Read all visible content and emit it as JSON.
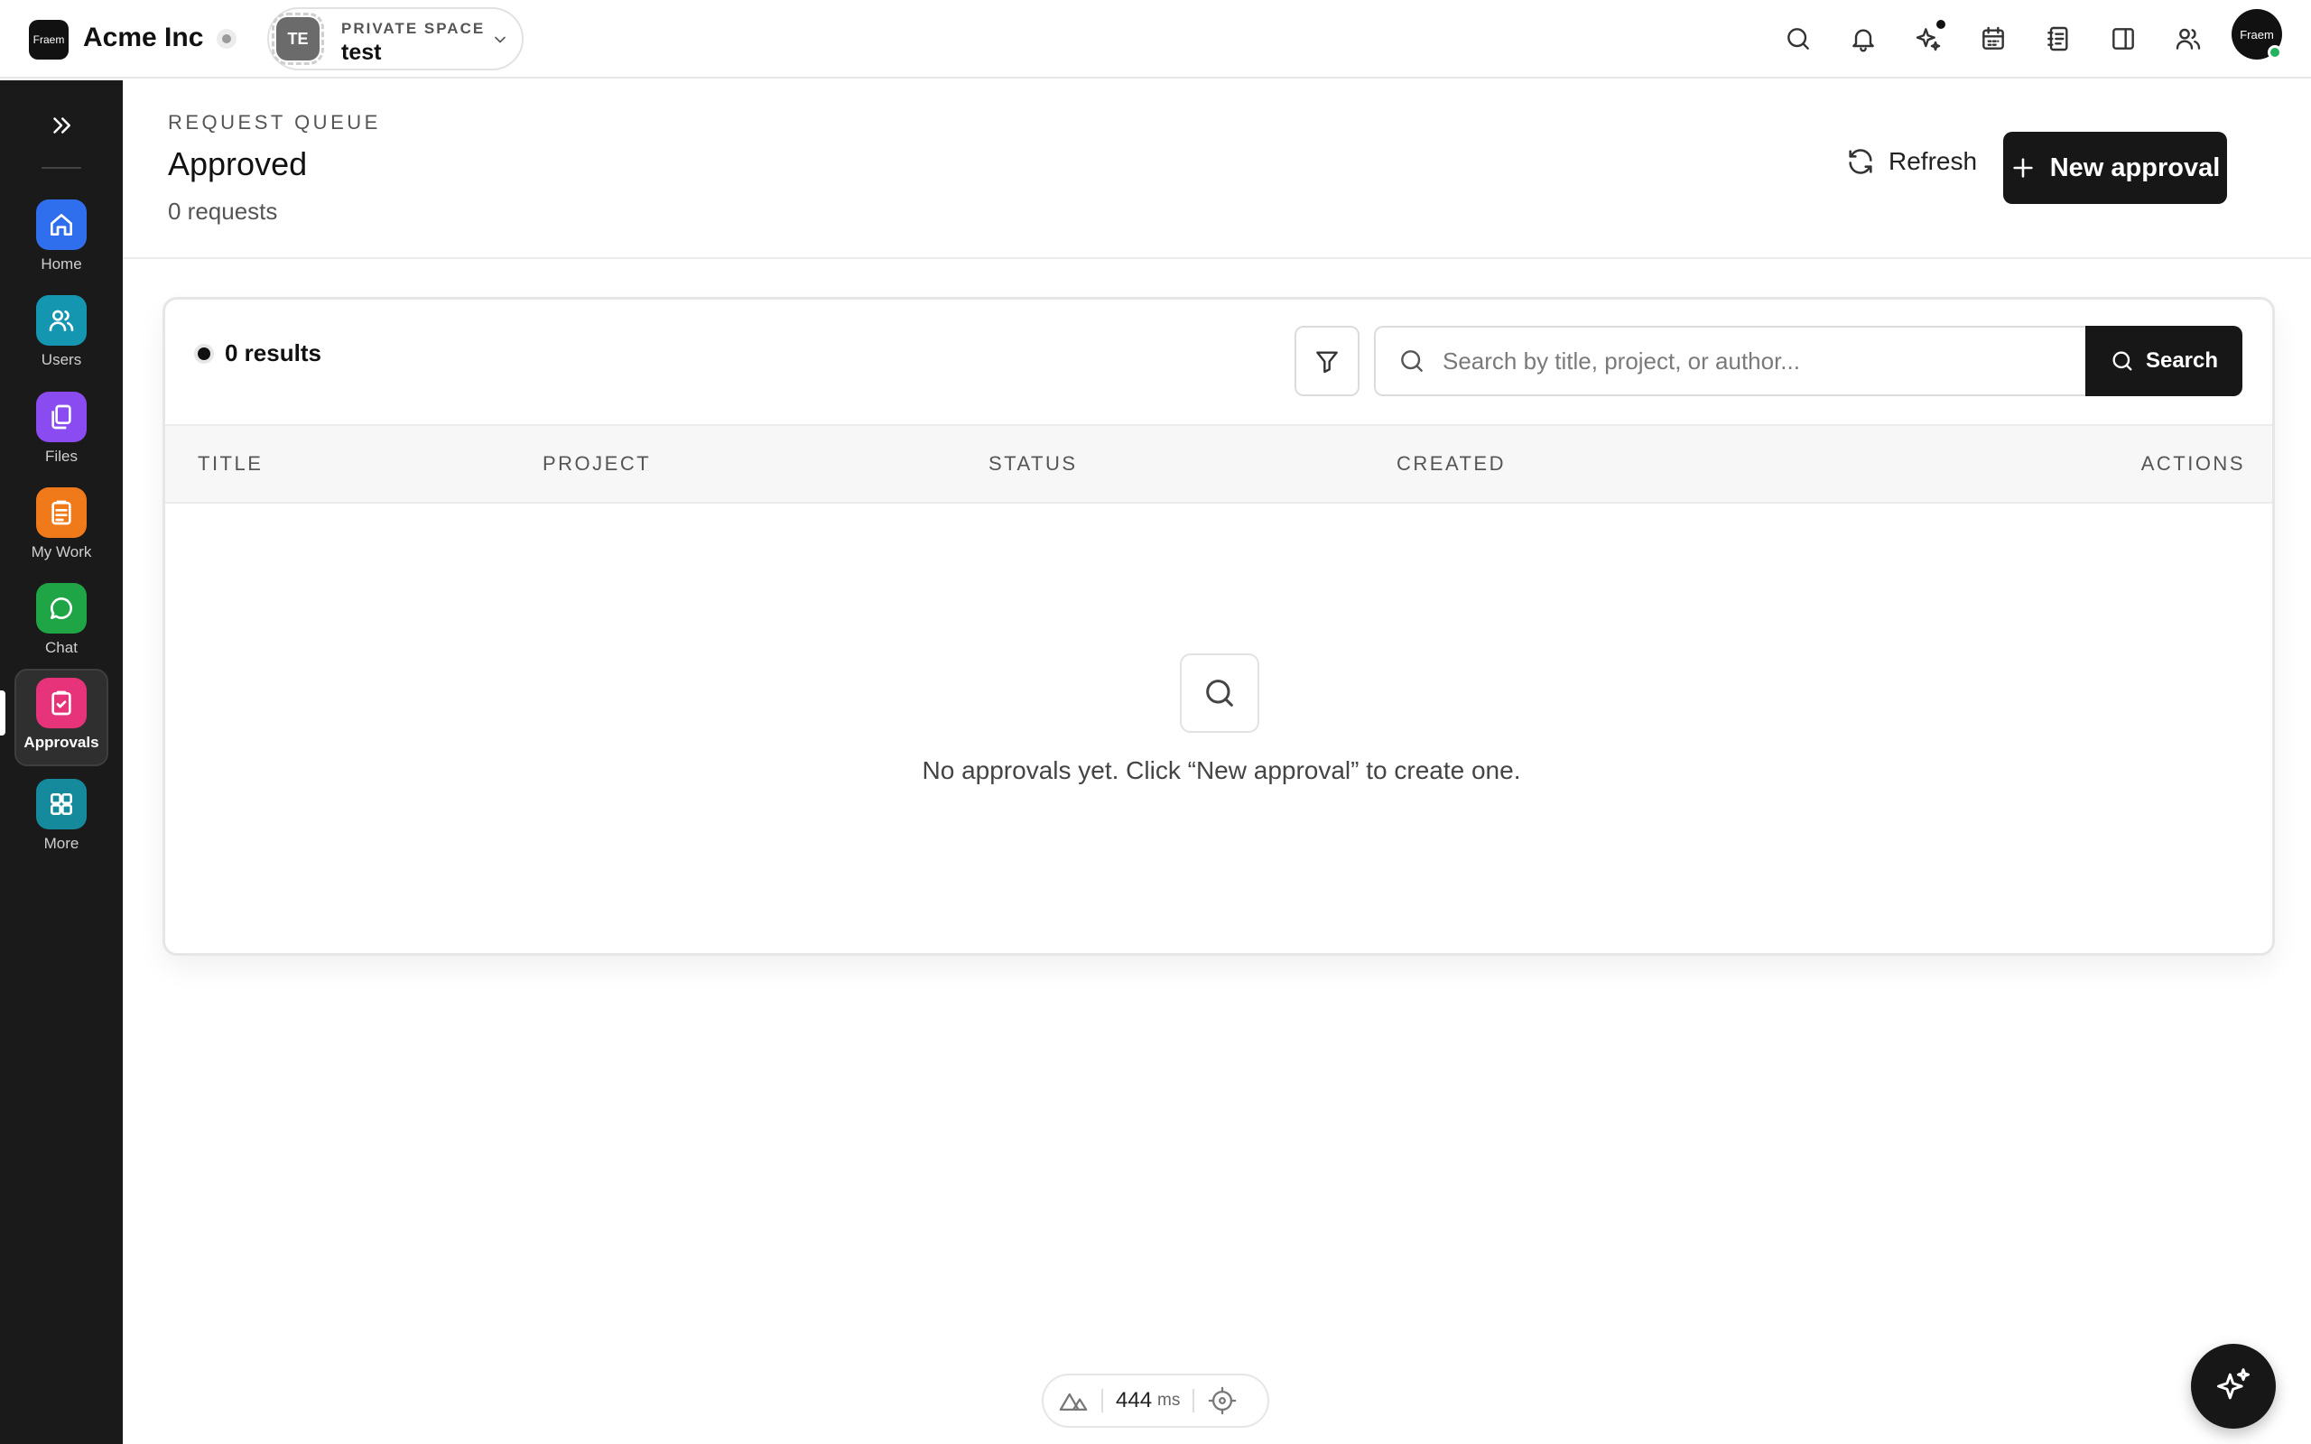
{
  "topbar": {
    "logo_text": "Fraem",
    "brand_name": "Acme Inc",
    "space": {
      "avatar_initials": "TE",
      "kicker": "PRIVATE SPACE",
      "name": "test"
    },
    "icons": [
      "search-icon",
      "bell-icon",
      "sparkles-icon",
      "calendar-icon",
      "notebook-icon",
      "panel-icon",
      "users-icon"
    ],
    "avatar_text": "Fraem"
  },
  "sidebar": {
    "items": [
      {
        "label": "Home",
        "icon": "home-icon",
        "color": "#2f6fed"
      },
      {
        "label": "Users",
        "icon": "users-icon",
        "color": "#1596b0"
      },
      {
        "label": "Files",
        "icon": "files-icon",
        "color": "#8a4cf0"
      },
      {
        "label": "My Work",
        "icon": "clipboard-icon",
        "color": "#f07a1a"
      },
      {
        "label": "Chat",
        "icon": "chat-icon",
        "color": "#1fa546"
      },
      {
        "label": "Approvals",
        "icon": "approvals-icon",
        "color": "#e6337a"
      },
      {
        "label": "More",
        "icon": "grid-icon",
        "color": "#148a9c"
      }
    ],
    "active": "Approvals"
  },
  "header": {
    "kicker": "REQUEST QUEUE",
    "title": "Approved",
    "count": "0 requests",
    "refresh_label": "Refresh",
    "new_label": "New approval"
  },
  "toolbar": {
    "results": "0 results",
    "search_placeholder": "Search by title, project, or author...",
    "search_label": "Search"
  },
  "table": {
    "columns": [
      "TITLE",
      "PROJECT",
      "STATUS",
      "CREATED",
      "ACTIONS"
    ],
    "rows": [],
    "empty_message": "No approvals yet. Click “New approval” to create one."
  },
  "footer": {
    "perf_value": "444",
    "perf_unit": "ms"
  },
  "colors": {
    "sidebar_bg": "#1a1a1a",
    "primary_button": "#171717",
    "online": "#22b35e"
  }
}
